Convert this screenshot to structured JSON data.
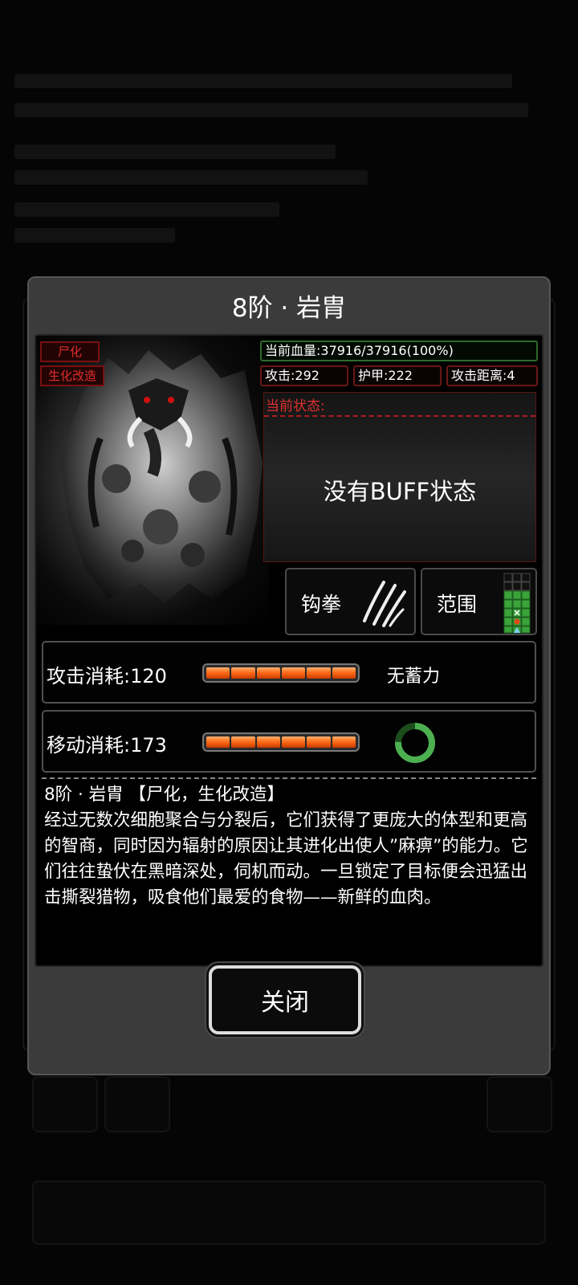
{
  "dialog": {
    "title": "8阶 · 岩胄",
    "tags": [
      "尸化",
      "生化改造"
    ],
    "stats": {
      "hp": "当前血量:37916/37916(100%)",
      "attack": "攻击:292",
      "armor": "护甲:222",
      "range": "攻击距离:4"
    },
    "status": {
      "label": "当前状态:",
      "empty_text": "没有BUFF状态"
    },
    "skills": {
      "attack_type": "钩拳",
      "range_label": "范围"
    },
    "costs": {
      "attack_label": "攻击消耗:120",
      "attack_fill": 1.0,
      "charge_text": "无蓄力",
      "move_label": "移动消耗:173",
      "move_fill": 1.0
    },
    "description": {
      "header": "8阶 · 岩胄 【尸化，生化改造】",
      "body": "经过无数次细胞聚合与分裂后，它们获得了更庞大的体型和更高的智商，同时因为辐射的原因让其进化出使人”麻痹”的能力。它们往往蛰伏在黑暗深处，伺机而动。一旦锁定了目标便会迅猛出击撕裂猎物，吸食他们最爱的食物——新鲜的血肉。"
    },
    "close_label": "关闭"
  },
  "colors": {
    "tag_red": "#e02c2c",
    "energy_orange": "#ff6d1a",
    "hp_border": "#2c6a2a",
    "stat_border": "#6a1717",
    "ring_green": "#4caf50"
  },
  "icons": [
    "claw-slash-icon",
    "range-grid-icon",
    "cooldown-ring-icon"
  ]
}
